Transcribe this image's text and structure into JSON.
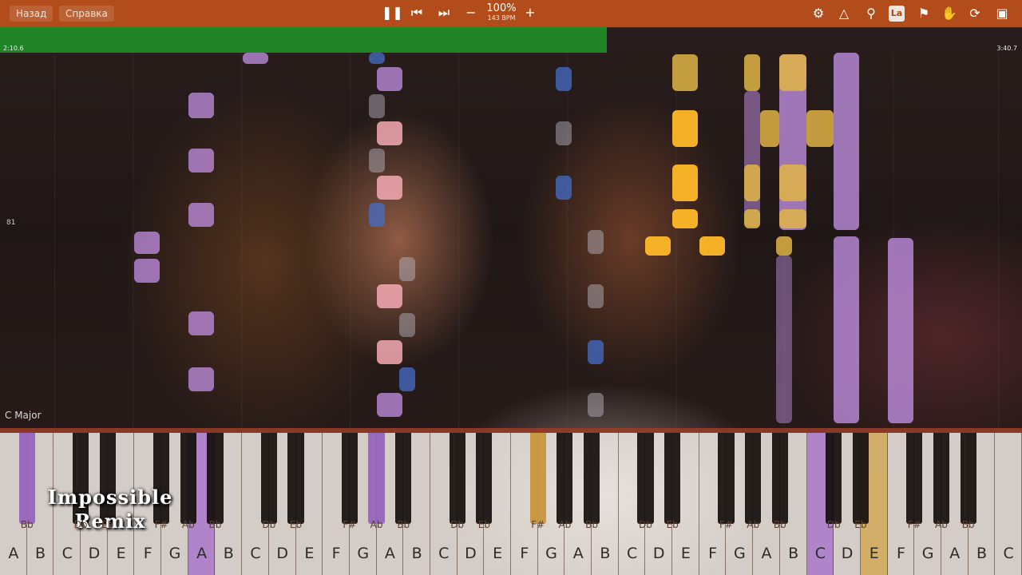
{
  "toolbar": {
    "back_label": "Назад",
    "help_label": "Справка",
    "zoom": "100%",
    "bpm": "143 BPM",
    "controls": {
      "pause": "pause-icon",
      "prev": "skip-back-icon",
      "next": "skip-forward-icon",
      "minus": "minus-icon",
      "plus": "plus-icon"
    },
    "right_icons": [
      "gear-icon",
      "metronome-icon",
      "search-icon",
      "la-icon",
      "bookmark-icon",
      "hand-icon",
      "loop-icon",
      "collapse-icon"
    ],
    "la_text": "La"
  },
  "progress": {
    "time_left": "2:10.6",
    "time_right": "3:40.7",
    "played_fraction": 0.594
  },
  "lane": {
    "marker": "81",
    "key_label": "C Major"
  },
  "overlay": {
    "line1": "Impossible",
    "line2": "Remix"
  },
  "keyboard": {
    "white_labels": [
      "A",
      "B",
      "C",
      "D",
      "E",
      "F",
      "G",
      "A",
      "B",
      "C",
      "D",
      "E",
      "F",
      "G",
      "A",
      "B",
      "C",
      "D",
      "E",
      "F",
      "G",
      "A",
      "B",
      "C",
      "D",
      "E",
      "F",
      "G",
      "A",
      "B",
      "C",
      "D",
      "E",
      "F",
      "G",
      "A",
      "B",
      "C"
    ],
    "black_labels": [
      "Bb",
      "Db",
      "Eb",
      "F#",
      "Ab",
      "Bb",
      "Db",
      "Eb",
      "F#",
      "Ab",
      "Bb",
      "Db",
      "Eb",
      "F#",
      "Ab",
      "Bb",
      "Db",
      "Eb",
      "F#",
      "Ab",
      "Bb",
      "Db",
      "Eb",
      "F#",
      "Ab",
      "Bb",
      "Db"
    ]
  },
  "colors": {
    "toolbar": "#b24d1b",
    "progress_fill": "#1e9628",
    "note_purple": "#be8cdc",
    "note_yellow": "#e1b446",
    "note_blue": "#466ec8",
    "note_pink": "#f5aab4"
  }
}
